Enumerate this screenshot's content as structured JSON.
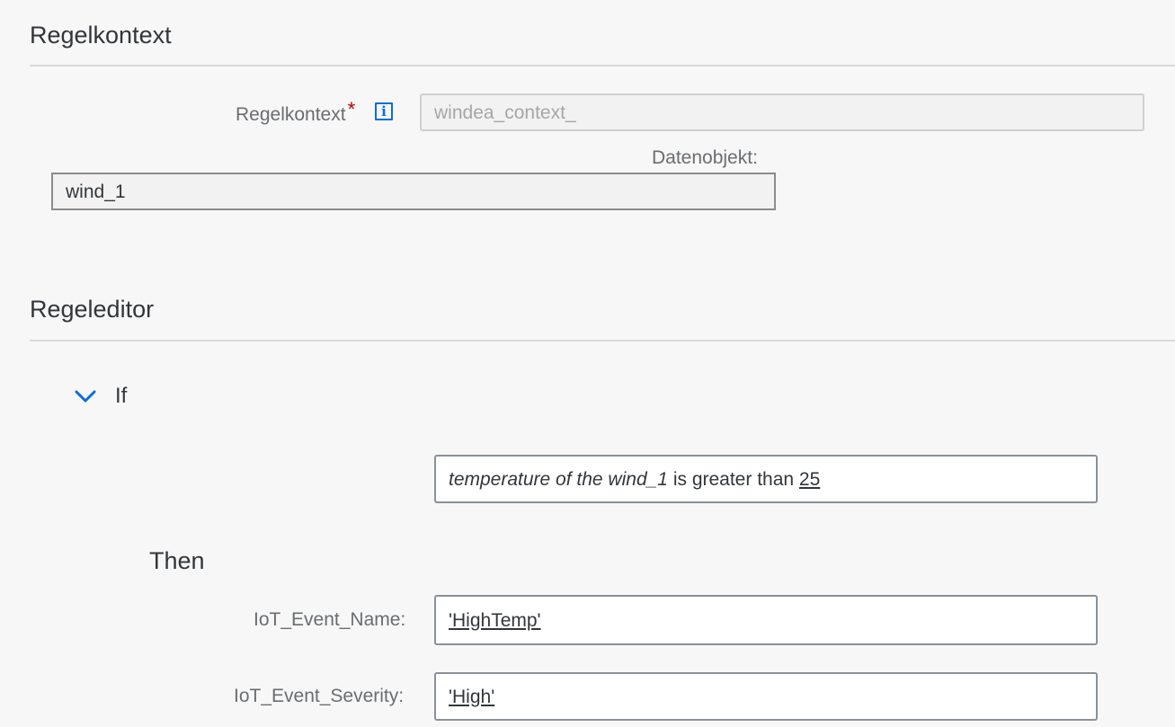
{
  "rule_context_section": {
    "title": "Regelkontext",
    "field_label": "Regelkontext",
    "required_mark": "*",
    "info_icon_glyph": "i",
    "field_placeholder": "windea_context_",
    "data_object_label": "Datenobjekt:",
    "data_object_value": "wind_1"
  },
  "rule_editor_section": {
    "title": "Regeleditor",
    "if_label": "If",
    "condition": {
      "subject": "temperature of the wind_1",
      "operator": " is greater than ",
      "value": "25"
    },
    "then_label": "Then",
    "assignments": [
      {
        "label": "IoT_Event_Name:",
        "value": "'HighTemp'"
      },
      {
        "label": "IoT_Event_Severity:",
        "value": "'High'"
      }
    ]
  },
  "colors": {
    "accent": "#0a6ed1",
    "required": "#bb0000",
    "background": "#f7f7f7"
  },
  "icons": {
    "info": "info-icon",
    "expand": "chevron-down-icon"
  }
}
